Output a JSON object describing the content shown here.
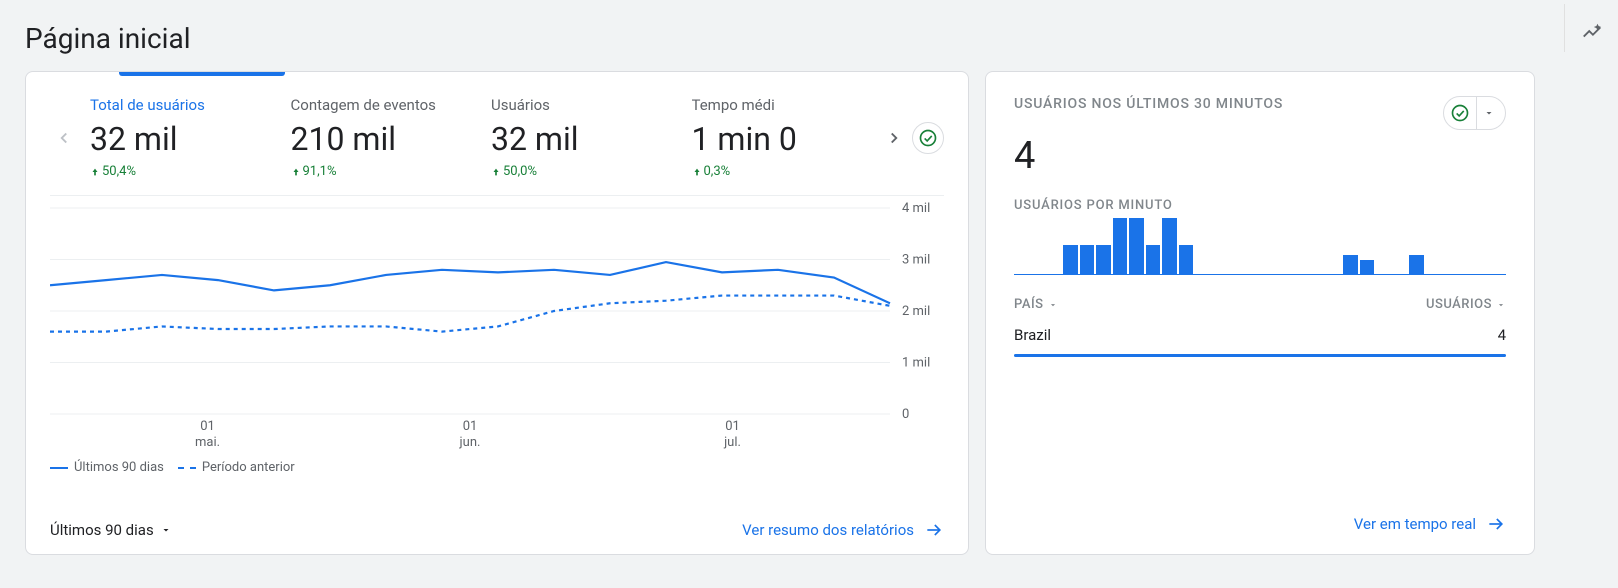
{
  "page_title": "Página inicial",
  "main_card": {
    "metrics": [
      {
        "label": "Total de usuários",
        "value": "32 mil",
        "delta": "50,4%",
        "active": true
      },
      {
        "label": "Contagem de eventos",
        "value": "210 mil",
        "delta": "91,1%",
        "active": false
      },
      {
        "label": "Usuários",
        "value": "32 mil",
        "delta": "50,0%",
        "active": false
      },
      {
        "label": "Tempo médi",
        "value": "1 min 0",
        "delta": "0,3%",
        "active": false
      }
    ],
    "range_label": "Últimos 90 dias",
    "footer_link": "Ver resumo dos relatórios",
    "legend": {
      "current": "Últimos 90 dias",
      "previous": "Período anterior"
    }
  },
  "chart_data": {
    "type": "line",
    "ylim": [
      0,
      4000
    ],
    "yticks": [
      "4 mil",
      "3 mil",
      "2 mil",
      "1 mil",
      "0"
    ],
    "xticks": [
      {
        "l1": "01",
        "l2": "mai."
      },
      {
        "l1": "01",
        "l2": "jun."
      },
      {
        "l1": "01",
        "l2": "jul."
      }
    ],
    "series": [
      {
        "name": "Últimos 90 dias",
        "style": "solid",
        "values": [
          2500,
          2600,
          2700,
          2600,
          2400,
          2500,
          2700,
          2800,
          2750,
          2800,
          2700,
          2950,
          2750,
          2800,
          2650,
          2150
        ]
      },
      {
        "name": "Período anterior",
        "style": "dashed",
        "values": [
          1600,
          1600,
          1700,
          1650,
          1650,
          1700,
          1700,
          1600,
          1700,
          2000,
          2150,
          2200,
          2300,
          2300,
          2300,
          2100
        ]
      }
    ]
  },
  "realtime": {
    "title": "USUÁRIOS NOS ÚLTIMOS 30 MINUTOS",
    "value": "4",
    "per_min_label": "USUÁRIOS POR MINUTO",
    "bars": [
      0,
      0,
      0,
      30,
      30,
      30,
      58,
      58,
      30,
      58,
      30,
      0,
      0,
      0,
      0,
      0,
      0,
      0,
      0,
      0,
      20,
      15,
      0,
      0,
      20,
      0,
      0,
      0,
      0,
      0
    ],
    "table": {
      "col_country": "PAÍS",
      "col_users": "USUÁRIOS",
      "rows": [
        {
          "country": "Brazil",
          "users": "4",
          "bar_pct": 100
        }
      ]
    },
    "footer_link": "Ver em tempo real"
  }
}
